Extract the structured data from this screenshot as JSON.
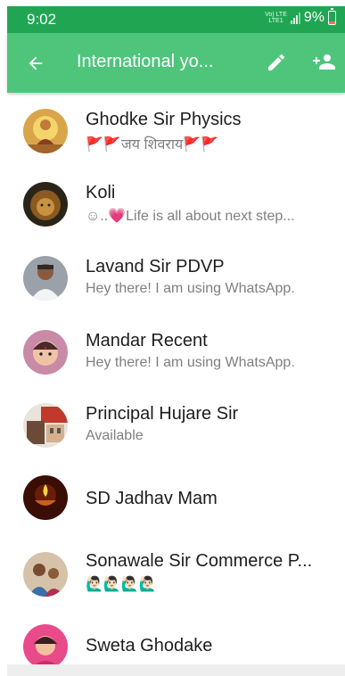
{
  "status_bar": {
    "time": "9:02",
    "network": "Vo) LTE",
    "network_sub": "LTE1",
    "battery": "9%"
  },
  "app_bar": {
    "title": "International yo...",
    "icons": [
      "back-arrow-icon",
      "pencil-icon",
      "add-contact-icon"
    ]
  },
  "contacts": [
    {
      "name": "Ghodke Sir Physics",
      "about": "🚩🚩जय शिवराय🚩🚩",
      "avatar": "shivaji-painting"
    },
    {
      "name": "Koli",
      "about": "☺..💗Life is all about next step...",
      "avatar": "lion"
    },
    {
      "name": "Lavand Sir PDVP",
      "about": "Hey there! I am using WhatsApp.",
      "avatar": "man-white-shirt"
    },
    {
      "name": "Mandar Recent",
      "about": "Hey there! I am using WhatsApp.",
      "avatar": "baby"
    },
    {
      "name": "Principal Hujare Sir",
      "about": "Available",
      "avatar": "building"
    },
    {
      "name": "SD Jadhav Mam",
      "about": "",
      "avatar": "diya-lamp"
    },
    {
      "name": "Sonawale Sir Commerce P...",
      "about": "🙋🏻‍♂️🙋🏻‍♂️🙋🏻‍♂️🙋🏻‍♂️",
      "avatar": "couple"
    },
    {
      "name": "Sweta Ghodake",
      "about": "",
      "avatar": "girl-pink"
    }
  ],
  "colors": {
    "status_bar": "#20a653",
    "app_bar": "#4fc57c",
    "name_text": "#1d1d1d",
    "about_text": "#7f7f7f"
  }
}
